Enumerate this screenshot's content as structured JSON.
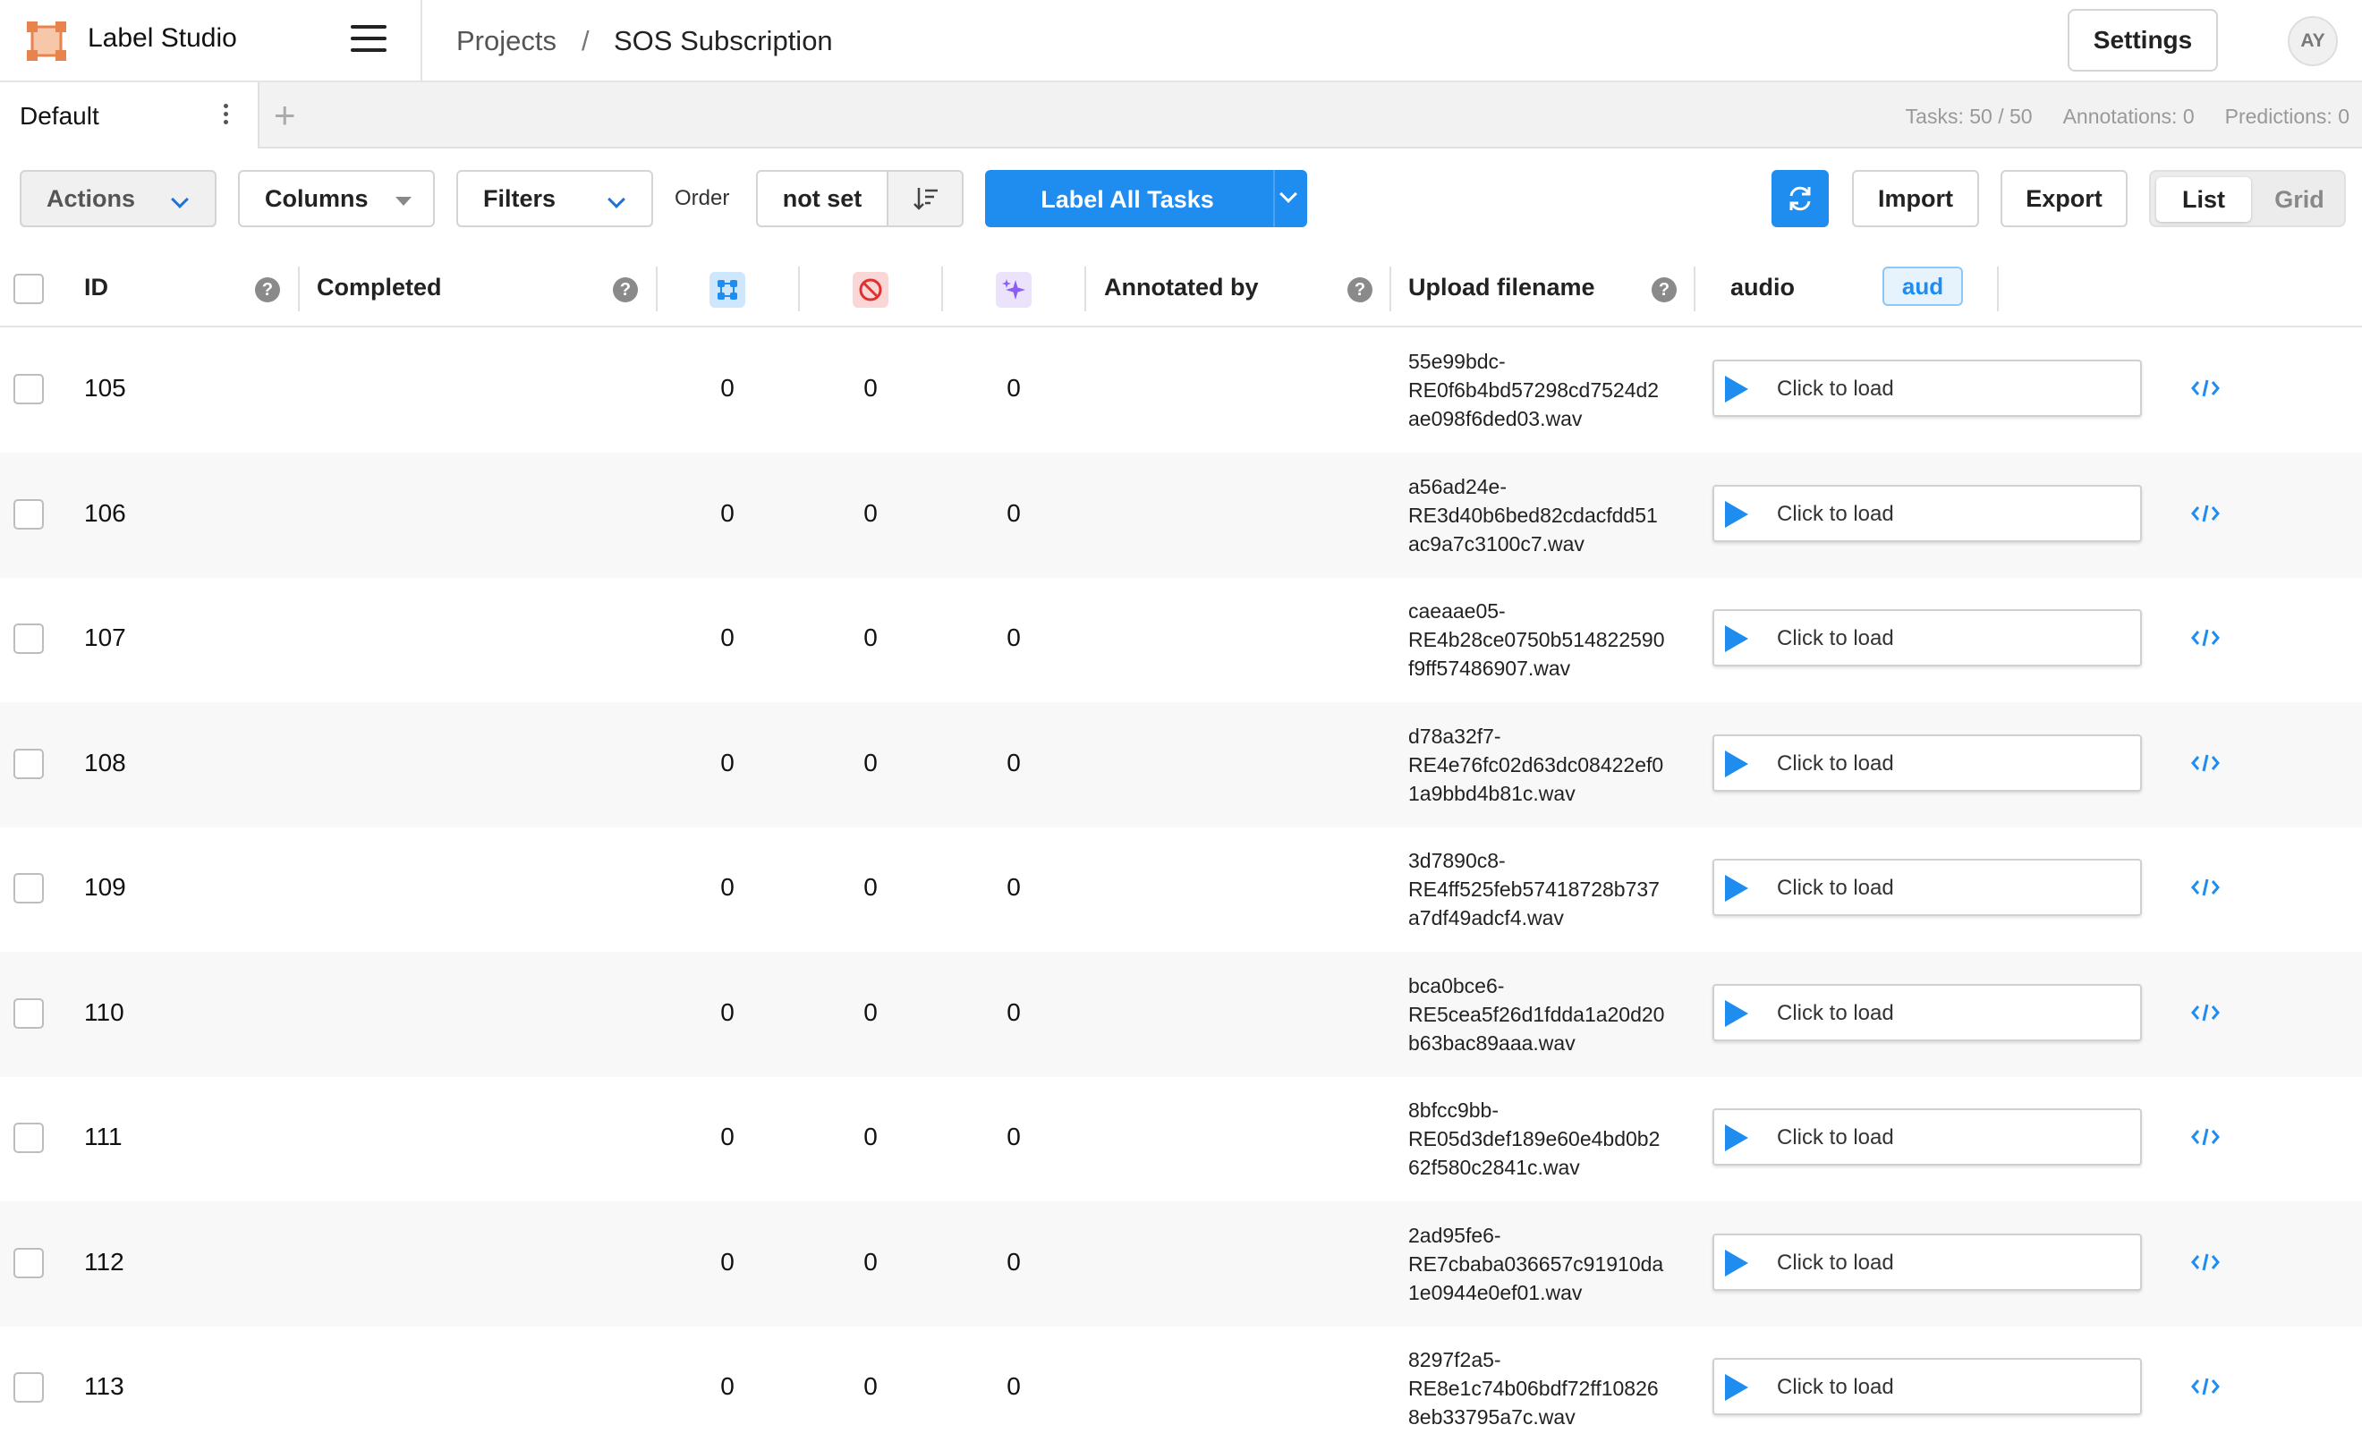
{
  "app": {
    "name": "Label Studio"
  },
  "breadcrumb": {
    "projects": "Projects",
    "separator": "/",
    "project": "SOS Subscription"
  },
  "header": {
    "settings_label": "Settings",
    "avatar_initials": "AY"
  },
  "tabs": {
    "default_label": "Default",
    "add_label": "+"
  },
  "stats": {
    "tasks": "Tasks: 50 / 50",
    "annotations": "Annotations: 0",
    "predictions": "Predictions: 0"
  },
  "toolbar": {
    "actions_label": "Actions",
    "columns_label": "Columns",
    "filters_label": "Filters",
    "order_label": "Order",
    "order_value": "not set",
    "label_all_label": "Label All Tasks",
    "import_label": "Import",
    "export_label": "Export",
    "view_list_label": "List",
    "view_grid_label": "Grid"
  },
  "columns": {
    "id": "ID",
    "completed": "Completed",
    "annotated_by": "Annotated by",
    "upload_filename": "Upload filename",
    "audio": "audio",
    "audio_badge": "aud",
    "help_glyph": "?"
  },
  "icons": {
    "total_annotations": "annotations-icon",
    "cancelled": "cancelled-icon",
    "predictions": "predictions-icon",
    "play": "play-icon",
    "code": "code-icon"
  },
  "colors": {
    "accent": "#1f8cf0",
    "logo": "#e8834d"
  },
  "audio_placeholder": "Click to load",
  "rows": [
    {
      "id": "105",
      "annotations": "0",
      "cancelled": "0",
      "predictions": "0",
      "filename": [
        "55e99bdc-",
        "RE0f6b4bd57298cd7524d2",
        "ae098f6ded03.wav"
      ]
    },
    {
      "id": "106",
      "annotations": "0",
      "cancelled": "0",
      "predictions": "0",
      "filename": [
        "a56ad24e-",
        "RE3d40b6bed82cdacfdd51",
        "ac9a7c3100c7.wav"
      ]
    },
    {
      "id": "107",
      "annotations": "0",
      "cancelled": "0",
      "predictions": "0",
      "filename": [
        "caeaae05-",
        "RE4b28ce0750b514822590",
        "f9ff57486907.wav"
      ]
    },
    {
      "id": "108",
      "annotations": "0",
      "cancelled": "0",
      "predictions": "0",
      "filename": [
        "d78a32f7-",
        "RE4e76fc02d63dc08422ef0",
        "1a9bbd4b81c.wav"
      ]
    },
    {
      "id": "109",
      "annotations": "0",
      "cancelled": "0",
      "predictions": "0",
      "filename": [
        "3d7890c8-",
        "RE4ff525feb57418728b737",
        "a7df49adcf4.wav"
      ]
    },
    {
      "id": "110",
      "annotations": "0",
      "cancelled": "0",
      "predictions": "0",
      "filename": [
        "bca0bce6-",
        "RE5cea5f26d1fdda1a20d20",
        "b63bac89aaa.wav"
      ]
    },
    {
      "id": "111",
      "annotations": "0",
      "cancelled": "0",
      "predictions": "0",
      "filename": [
        "8bfcc9bb-",
        "RE05d3def189e60e4bd0b2",
        "62f580c2841c.wav"
      ]
    },
    {
      "id": "112",
      "annotations": "0",
      "cancelled": "0",
      "predictions": "0",
      "filename": [
        "2ad95fe6-",
        "RE7cbaba036657c91910da",
        "1e0944e0ef01.wav"
      ]
    },
    {
      "id": "113",
      "annotations": "0",
      "cancelled": "0",
      "predictions": "0",
      "filename": [
        "8297f2a5-",
        "RE8e1c74b06bdf72ff10826",
        "8eb33795a7c.wav"
      ]
    }
  ]
}
